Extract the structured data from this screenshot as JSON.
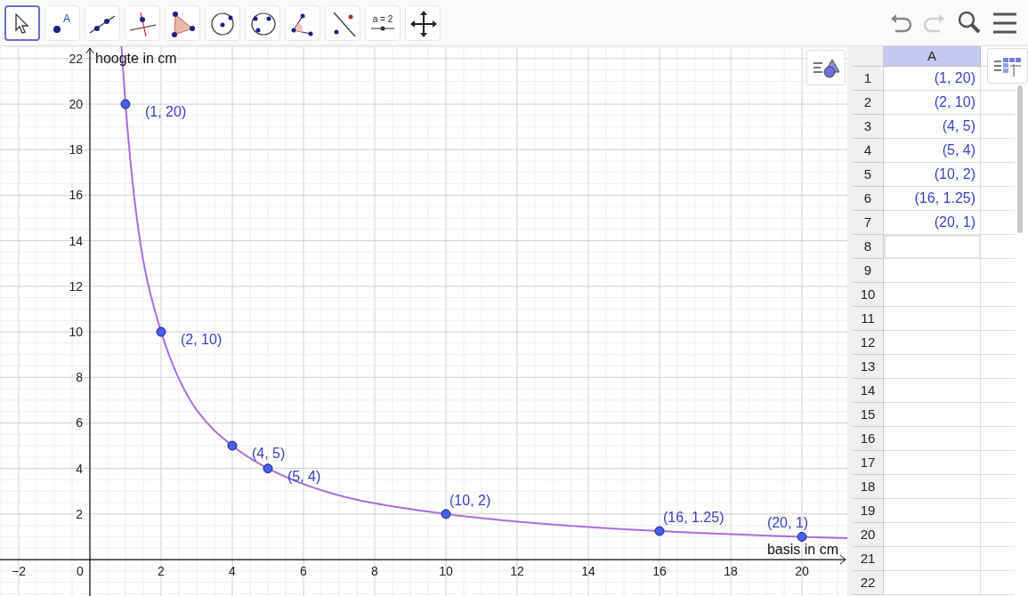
{
  "toolbar": {
    "tools": [
      {
        "kind": "move",
        "selected": true
      },
      {
        "kind": "point",
        "label": "A",
        "selected": false
      },
      {
        "kind": "line",
        "selected": false
      },
      {
        "kind": "perpendicular",
        "selected": false
      },
      {
        "kind": "polygon",
        "selected": false
      },
      {
        "kind": "circle",
        "selected": false
      },
      {
        "kind": "circle3",
        "selected": false
      },
      {
        "kind": "angle",
        "selected": false
      },
      {
        "kind": "reflect",
        "selected": false
      },
      {
        "kind": "slider",
        "selected": false
      },
      {
        "kind": "pan",
        "selected": false
      }
    ],
    "slider_label": "a = 2",
    "actions": [
      {
        "kind": "undo",
        "disabled": false
      },
      {
        "kind": "redo",
        "disabled": true
      },
      {
        "kind": "search"
      },
      {
        "kind": "menu"
      }
    ]
  },
  "graphics": {
    "chart_data": {
      "type": "line",
      "xlabel": "basis in cm",
      "ylabel": "hoogte in cm",
      "x": [
        0.8873,
        1,
        2,
        4,
        5,
        10,
        16,
        20,
        21.275
      ],
      "series": [
        {
          "color": "#a86de0",
          "marker": true,
          "values": [
            22.54,
            20,
            10,
            5,
            4,
            2,
            1.25,
            1,
            0.94
          ]
        }
      ],
      "grid": true,
      "value_labels": [
        null,
        "(1, 20)",
        "(2, 10)",
        "(4, 5)",
        "(5, 4)",
        "(10, 2)",
        "(16, 1.25)",
        "(20, 1)",
        null
      ],
      "xlim": [
        -2.525,
        21.275
      ],
      "ylim": [
        -1.6,
        22.54
      ],
      "xticks": [
        {
          "value": -2,
          "label": "−2"
        },
        0,
        2,
        4,
        6,
        8,
        10,
        12,
        14,
        16,
        18,
        20
      ],
      "yticks": [
        2,
        4,
        6,
        8,
        10,
        12,
        14,
        16,
        18,
        20,
        22
      ]
    }
  },
  "spreadsheet": {
    "column": "A",
    "rows": [
      {
        "number": "1",
        "value": "(1, 20)",
        "selected": false
      },
      {
        "number": "2",
        "value": "(2, 10)",
        "selected": false
      },
      {
        "number": "3",
        "value": "(4, 5)",
        "selected": false
      },
      {
        "number": "4",
        "value": "(5, 4)",
        "selected": false
      },
      {
        "number": "5",
        "value": "(10, 2)",
        "selected": false
      },
      {
        "number": "6",
        "value": "(16, 1.25)",
        "selected": false
      },
      {
        "number": "7",
        "value": "(20, 1)",
        "selected": false
      },
      {
        "number": "8",
        "selected": true
      },
      {
        "number": "9",
        "selected": false
      },
      {
        "number": "10",
        "selected": false
      },
      {
        "number": "11",
        "selected": false
      },
      {
        "number": "12",
        "selected": false
      },
      {
        "number": "13",
        "selected": false
      },
      {
        "number": "14",
        "selected": false
      },
      {
        "number": "15",
        "selected": false
      },
      {
        "number": "16",
        "selected": false
      },
      {
        "number": "17",
        "selected": false
      },
      {
        "number": "18",
        "selected": false
      },
      {
        "number": "19",
        "selected": false
      },
      {
        "number": "20",
        "selected": false
      },
      {
        "number": "21",
        "selected": false
      },
      {
        "number": "22",
        "selected": false
      }
    ]
  }
}
